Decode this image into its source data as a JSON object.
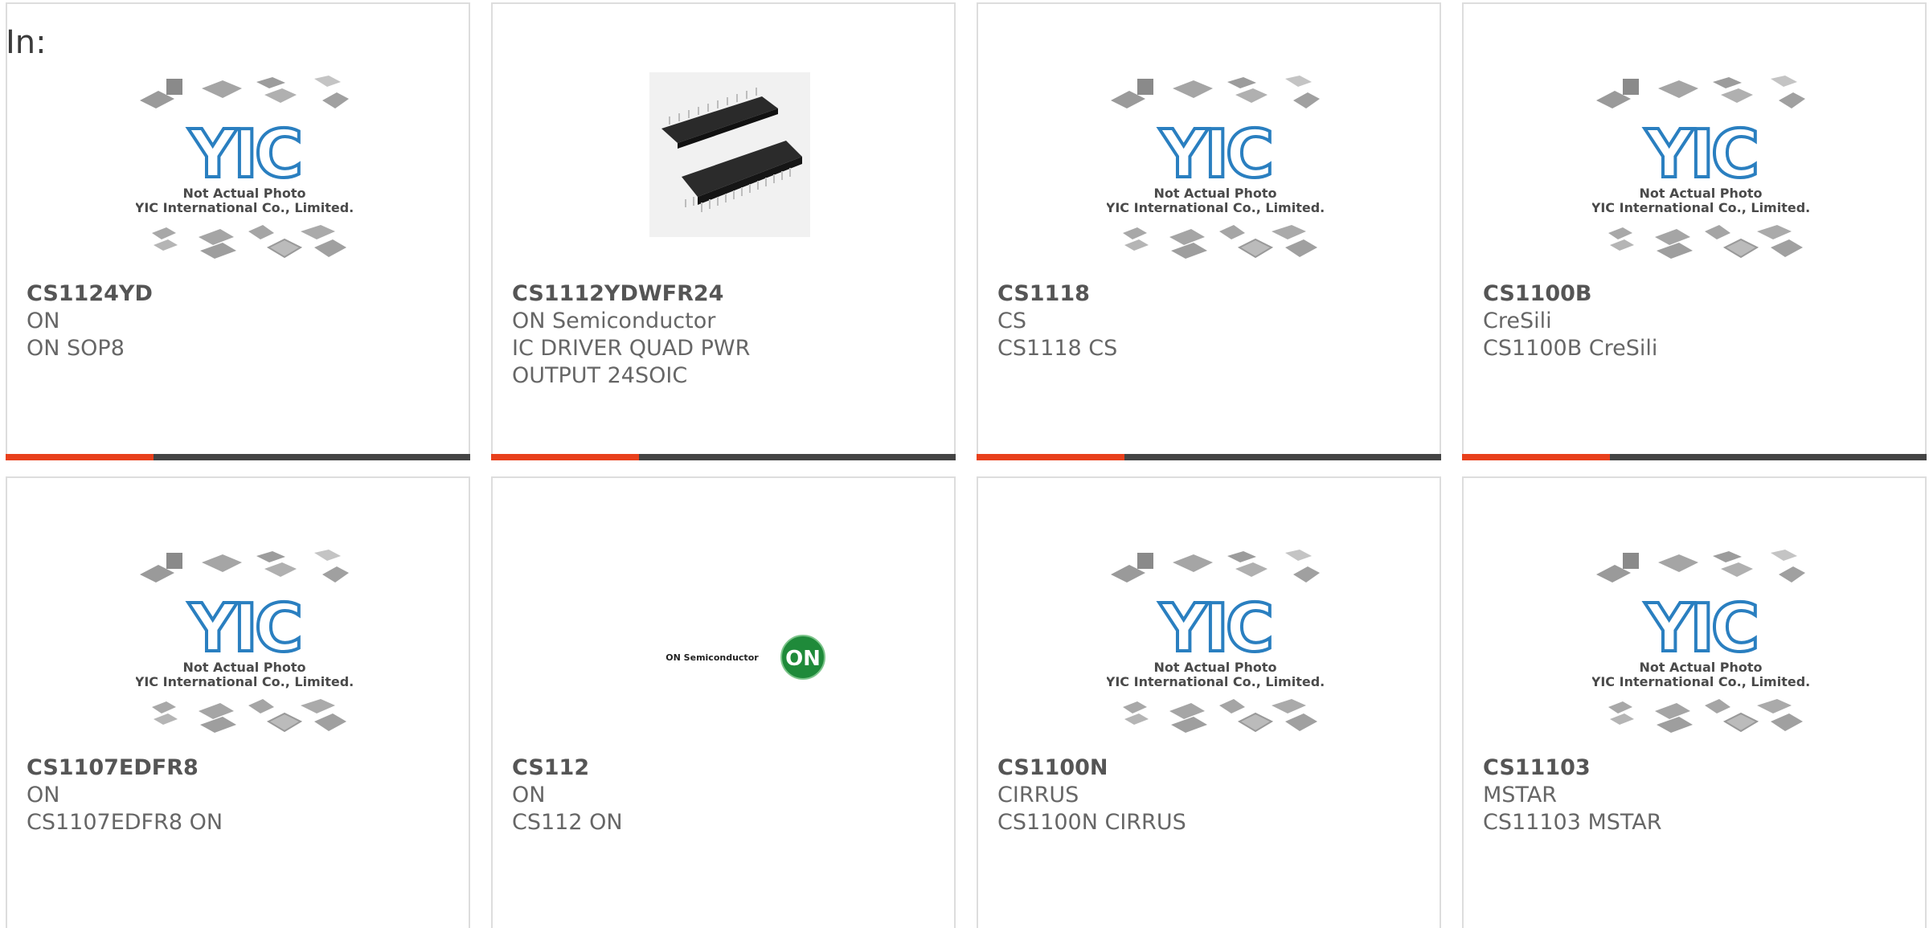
{
  "filter_label": "In:",
  "placeholder_caption": {
    "line1": "Not Actual Photo",
    "line2": "YIC International Co., Limited.",
    "logo": "YIC"
  },
  "brand_logo_text": {
    "name": "ON Semiconductor",
    "mark": "ON"
  },
  "colors": {
    "accent": "#e8401c",
    "bar": "#444444",
    "yic_blue": "#2a7fc0",
    "on_green": "#1f8a3a"
  },
  "products": [
    {
      "part": "CS1124YD",
      "maker": "ON",
      "desc": "ON SOP8",
      "image": "placeholder"
    },
    {
      "part": "CS1112YDWFR24",
      "maker": "ON Semiconductor",
      "desc": "IC DRIVER QUAD PWR OUTPUT 24SOIC",
      "image": "chip-photo"
    },
    {
      "part": "CS1118",
      "maker": "CS",
      "desc": "CS1118 CS",
      "image": "placeholder"
    },
    {
      "part": "CS1100B",
      "maker": "CreSili",
      "desc": "CS1100B CreSili",
      "image": "placeholder"
    },
    {
      "part": "CS1107EDFR8",
      "maker": "ON",
      "desc": "CS1107EDFR8 ON",
      "image": "placeholder"
    },
    {
      "part": "CS112",
      "maker": "ON",
      "desc": "CS112 ON",
      "image": "on-logo"
    },
    {
      "part": "CS1100N",
      "maker": "CIRRUS",
      "desc": "CS1100N CIRRUS",
      "image": "placeholder"
    },
    {
      "part": "CS11103",
      "maker": "MSTAR",
      "desc": "CS11103 MSTAR",
      "image": "placeholder"
    }
  ]
}
